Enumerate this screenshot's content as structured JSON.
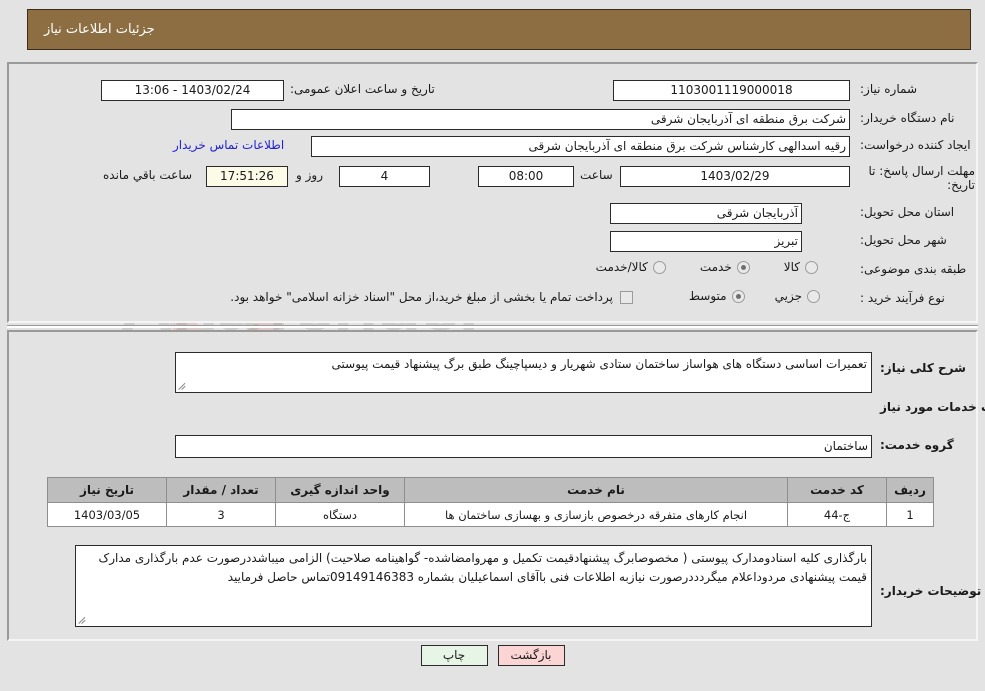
{
  "header": {
    "title": "جزئیات اطلاعات نیاز"
  },
  "watermark": {
    "brand": "AriaTender",
    "suffix": ".net",
    "mark": "V"
  },
  "form": {
    "need_number_label": "شماره نیاز:",
    "need_number_value": "1103001119000018",
    "public_announce_label": "تاریخ و ساعت اعلان عمومی:",
    "public_announce_value": "1403/02/24 - 13:06",
    "buyer_org_label": "نام دستگاه خریدار:",
    "buyer_org_value": "شرکت برق منطقه ای آذربایجان شرقی",
    "requester_label": "ایجاد کننده درخواست:",
    "requester_value": "رقیه اسدالهی کارشناس شرکت برق منطقه ای آذربایجان شرقی",
    "buyer_contact_link": "اطلاعات تماس خریدار",
    "deadline_label": "مهلت ارسال پاسخ: تا تاریخ:",
    "deadline_date": "1403/02/29",
    "hour_label": "ساعت",
    "deadline_time": "08:00",
    "days_value": "4",
    "days_label": "روز و",
    "remaining_time": "17:51:26",
    "remaining_label": "ساعت باقي مانده",
    "province_label": "استان محل تحویل:",
    "province_value": "آذربایجان شرقی",
    "city_label": "شهر محل تحویل:",
    "city_value": "تبریز",
    "category_label": "طبقه بندی موضوعی:",
    "category_options": [
      {
        "label": "کالا",
        "selected": false
      },
      {
        "label": "خدمت",
        "selected": true
      },
      {
        "label": "کالا/خدمت",
        "selected": false
      }
    ],
    "process_label": "نوع فرآیند خرید :",
    "process_options": [
      {
        "label": "جزیي",
        "selected": false
      },
      {
        "label": "متوسط",
        "selected": true
      }
    ],
    "treasury_checkbox_label": "پرداخت تمام یا بخشی از مبلغ خرید،از محل \"اسناد خزانه اسلامی\" خواهد بود.",
    "treasury_checked": false
  },
  "needs": {
    "general_desc_label": "شرح کلی نیاز:",
    "general_desc_value": "تعمیرات اساسی دستگاه های هواساز ساختمان ستادی شهریار و دیسپاچینگ طبق برگ پیشنهاد قیمت پیوستی",
    "services_info_title": "اطلاعات خدمات مورد نیاز",
    "service_group_label": "گروه خدمت:",
    "service_group_value": "ساختمان"
  },
  "table": {
    "headers": [
      "ردیف",
      "کد خدمت",
      "نام خدمت",
      "واحد اندازه گیری",
      "تعداد / مقدار",
      "تاریخ نیاز"
    ],
    "rows": [
      {
        "row_no": "1",
        "service_code": "ج-44",
        "service_name": "انجام کارهای متفرقه درخصوص بازسازی و بهسازی ساختمان ها",
        "unit": "دستگاه",
        "quantity": "3",
        "need_date": "1403/03/05"
      }
    ]
  },
  "buyer_notes": {
    "label": "توضیحات خریدار:",
    "value": "بارگذاری کلیه اسنادومدارک پیوستی ( مخصوصابرگ پیشنهادقیمت تکمیل و مهروامضاشده- گواهینامه صلاحیت) الزامی میباشددرصورت عدم بارگذاری مدارک قیمت پیشنهادی مردوداعلام میگردددرصورت نیازبه اطلاعات فنی باآقای اسماعیلیان بشماره 09149146383تماس حاصل فرمایید"
  },
  "footer": {
    "print_label": "چاپ",
    "back_label": "بازگشت"
  }
}
